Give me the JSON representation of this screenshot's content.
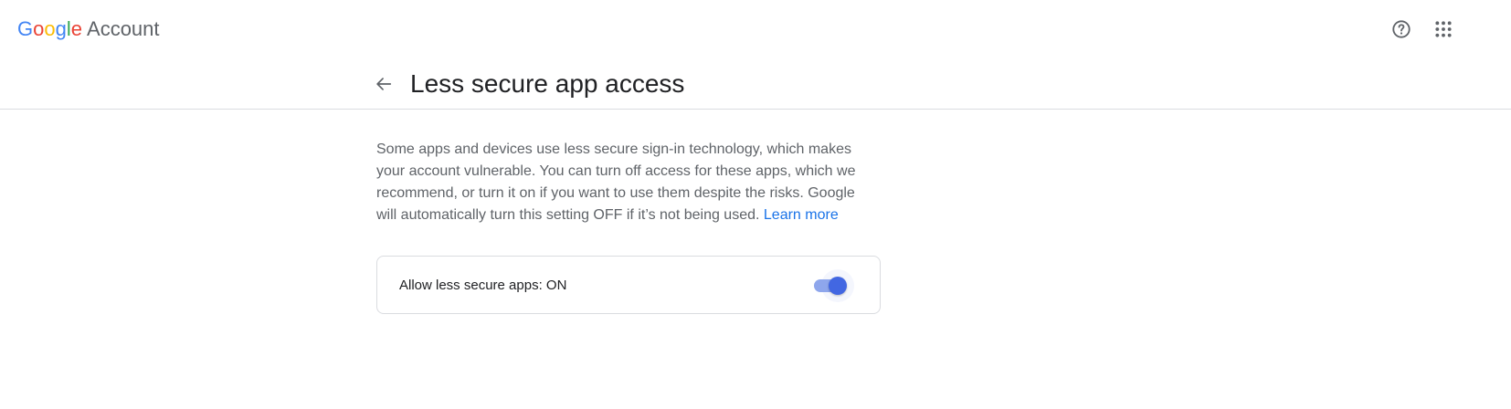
{
  "header": {
    "logo": {
      "letters": [
        "G",
        "o",
        "o",
        "g",
        "l",
        "e"
      ],
      "suffix": "Account"
    },
    "help_icon": "help-circle-icon",
    "apps_icon": "apps-grid-icon"
  },
  "page": {
    "title": "Less secure app access",
    "back_icon": "arrow-back-icon"
  },
  "description": {
    "text": "Some apps and devices use less secure sign-in technology, which makes your account vulnerable. You can turn off access for these apps, which we recommend, or turn it on if you want to use them despite the risks. Google will automatically turn this setting OFF if it’s not being used.",
    "link": "Learn more"
  },
  "setting": {
    "label": "Allow less secure apps: ON",
    "enabled": true
  },
  "colors": {
    "brand_blue": "#4285F4",
    "brand_red": "#EA4335",
    "brand_yellow": "#FBBC05",
    "brand_green": "#34A853",
    "link": "#1a73e8",
    "toggle_on": "#4267e2"
  }
}
